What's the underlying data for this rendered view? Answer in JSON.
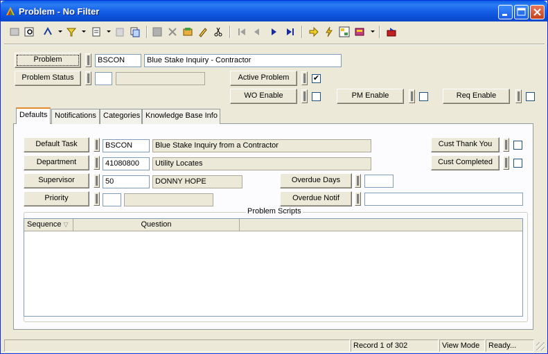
{
  "window": {
    "title": "Problem - No Filter"
  },
  "toolbar": {
    "icons": [
      "new-record-icon",
      "search-icon",
      "sort-icon",
      "filter-icon",
      "print-icon",
      "copy-icon",
      "clone-icon",
      "save-icon",
      "delete-icon",
      "add-note-icon",
      "edit-icon",
      "cut-icon",
      "first-record-icon",
      "prev-record-icon",
      "next-record-icon",
      "last-record-icon",
      "go-icon",
      "lightning-icon",
      "workflow-icon",
      "books-icon",
      "exit-icon"
    ]
  },
  "header": {
    "problem_label": "Problem",
    "problem_code": "BSCON",
    "problem_desc": "Blue Stake Inquiry - Contractor",
    "problem_status_label": "Problem Status",
    "problem_status_code": "",
    "problem_status_desc": "",
    "active_problem_label": "Active Problem",
    "active_problem_checked": "✔",
    "wo_enable_label": "WO Enable",
    "pm_enable_label": "PM Enable",
    "req_enable_label": "Req Enable"
  },
  "tabs": [
    "Defaults",
    "Notifications",
    "Categories",
    "Knowledge Base Info"
  ],
  "defaults": {
    "default_task_label": "Default Task",
    "default_task_code": "BSCON",
    "default_task_desc": "Blue Stake Inquiry from a Contractor",
    "department_label": "Department",
    "department_code": "41080800",
    "department_desc": "Utility Locates",
    "supervisor_label": "Supervisor",
    "supervisor_code": "50",
    "supervisor_desc": "DONNY HOPE",
    "priority_label": "Priority",
    "priority_code": "",
    "priority_desc": "",
    "overdue_days_label": "Overdue Days",
    "overdue_days_value": "",
    "overdue_notif_label": "Overdue Notif",
    "overdue_notif_value": "",
    "cust_thank_you_label": "Cust Thank You",
    "cust_completed_label": "Cust Completed"
  },
  "scripts": {
    "group_label": "Problem Scripts",
    "columns": [
      "Sequence",
      "Question"
    ]
  },
  "status": {
    "record": "Record 1 of 302",
    "mode": "View Mode",
    "state": "Ready..."
  }
}
